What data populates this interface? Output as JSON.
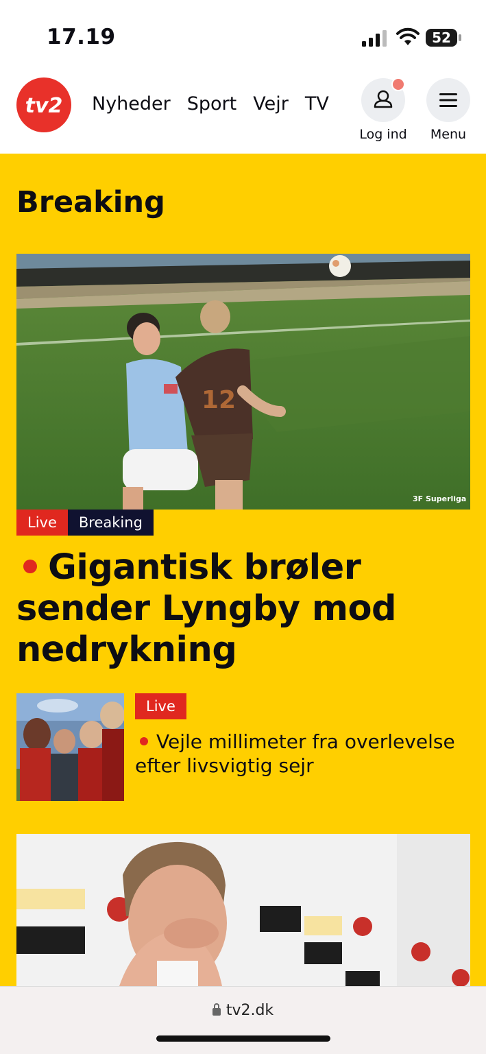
{
  "status_bar": {
    "time": "17.19",
    "battery": "52"
  },
  "header": {
    "logo_text": "TV2",
    "nav": [
      "Nyheder",
      "Sport",
      "Vejr",
      "TV"
    ],
    "login_label": "Log ind",
    "menu_label": "Menu"
  },
  "section": {
    "title": "Breaking"
  },
  "hero": {
    "image_watermark": "3F Superliga",
    "tags": {
      "live": "Live",
      "breaking": "Breaking"
    },
    "headline": "Gigantisk brøler sender Lyngby mod nedrykning"
  },
  "secondary": {
    "tag": "Live",
    "headline": "Vejle millimeter fra overlevelse efter livsvigtig sejr"
  },
  "browser": {
    "url": "tv2.dk"
  },
  "colors": {
    "accent_yellow": "#ffcf00",
    "live_red": "#e0281f",
    "breaking_navy": "#101230",
    "logo_red": "#e8312a"
  }
}
